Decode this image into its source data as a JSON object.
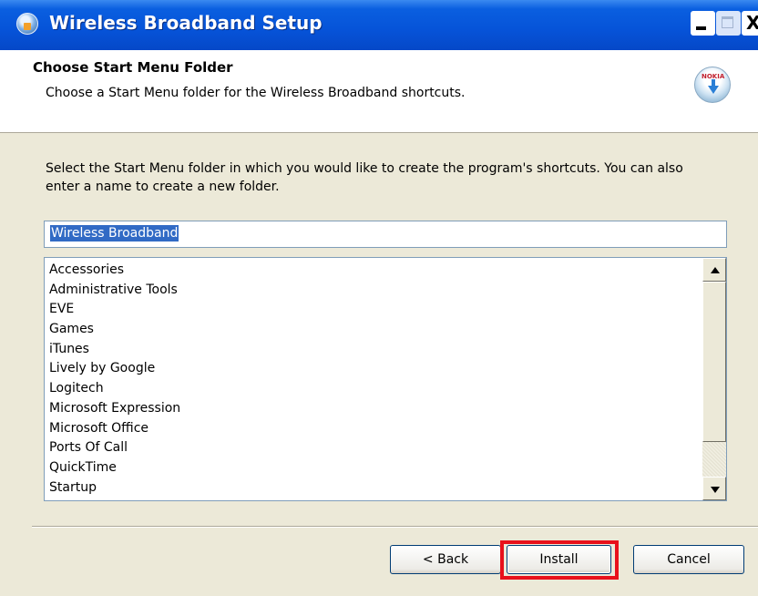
{
  "window": {
    "title": "Wireless Broadband Setup"
  },
  "titlebar_buttons": {
    "minimize_icon": "minimize-icon",
    "maximize_icon": "maximize-icon",
    "close_glyph": "X"
  },
  "header": {
    "title": "Choose Start Menu Folder",
    "subtitle": "Choose a Start Menu folder for the Wireless Broadband shortcuts.",
    "brand_logo_text": "NOKIA"
  },
  "instruction": "Select the Start Menu folder in which you would like to create the program's shortcuts. You can also enter a name to create a new folder.",
  "folder_input": {
    "value": "Wireless Broadband"
  },
  "folder_list": {
    "items": [
      "Accessories",
      "Administrative Tools",
      "EVE",
      "Games",
      "iTunes",
      "Lively by Google",
      "Logitech",
      "Microsoft Expression",
      "Microsoft Office",
      "Ports Of Call",
      "QuickTime",
      "Startup"
    ]
  },
  "buttons": {
    "back": "< Back",
    "install": "Install",
    "cancel": "Cancel"
  },
  "colors": {
    "titlebar": "#0653d8",
    "highlight": "#e8111b",
    "selection": "#316ac5"
  }
}
